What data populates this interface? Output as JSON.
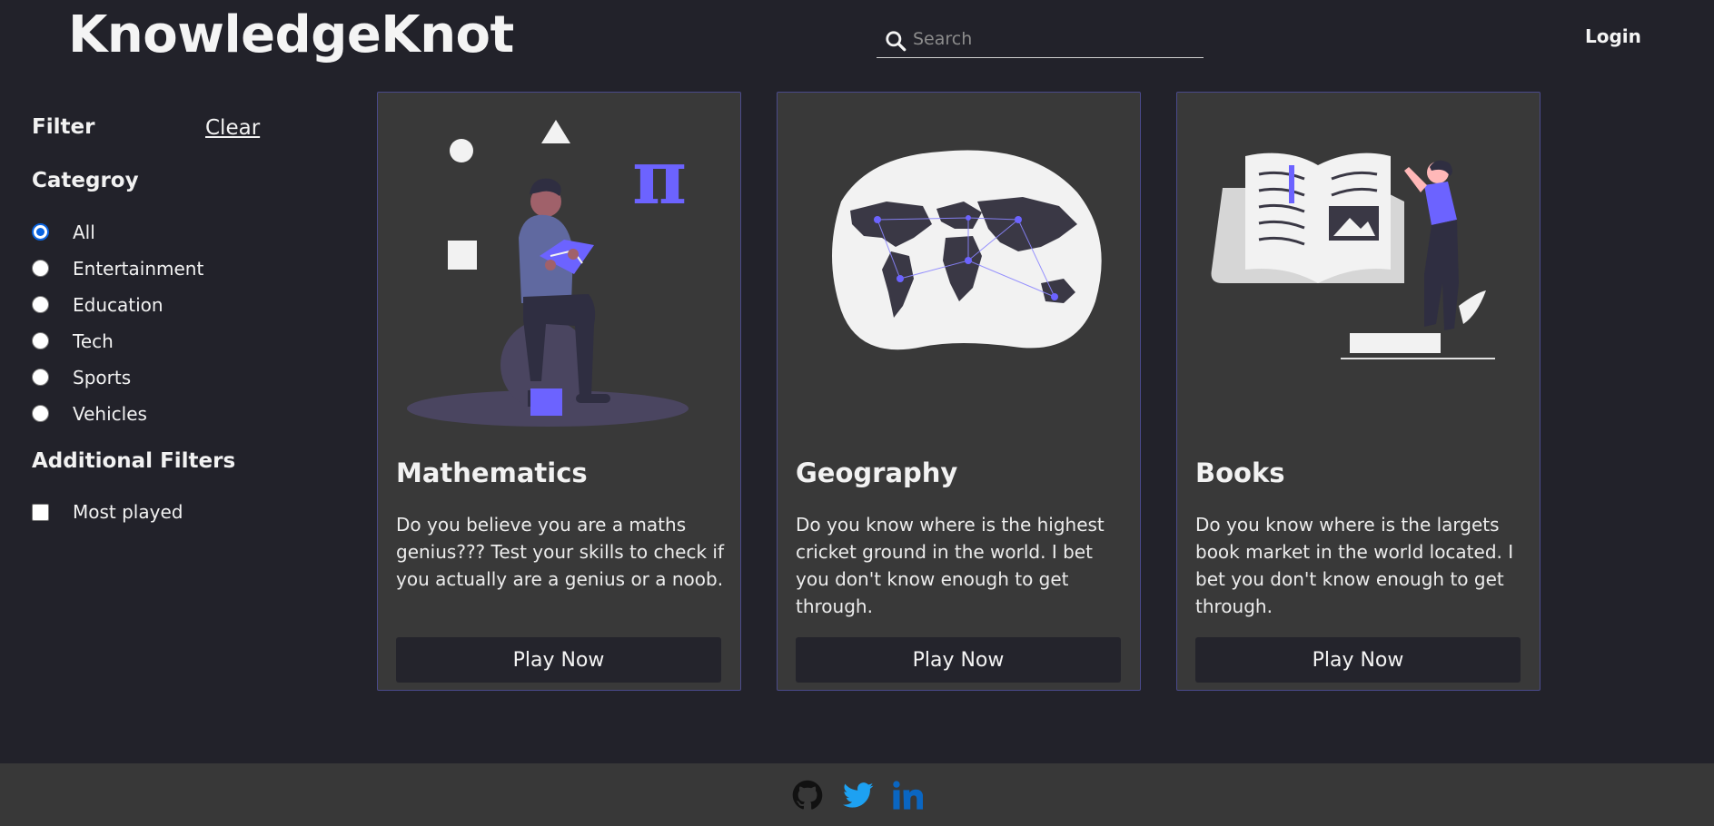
{
  "header": {
    "logo": "KnowledgeKnot",
    "search_placeholder": "Search",
    "login_label": "Login"
  },
  "sidebar": {
    "filter_title": "Filter",
    "clear_label": "Clear",
    "category_title": "Categroy",
    "categories": [
      {
        "label": "All",
        "checked": true
      },
      {
        "label": "Entertainment",
        "checked": false
      },
      {
        "label": "Education",
        "checked": false
      },
      {
        "label": "Tech",
        "checked": false
      },
      {
        "label": "Sports",
        "checked": false
      },
      {
        "label": "Vehicles",
        "checked": false
      }
    ],
    "additional_title": "Additional Filters",
    "additional": [
      {
        "label": "Most played",
        "checked": false
      }
    ]
  },
  "cards": [
    {
      "title": "Mathematics",
      "description": "Do you believe you are a maths genius??? Test your skills to check if you actually are a genius or a noob.",
      "button": "Play Now",
      "icon": "math-illustration"
    },
    {
      "title": "Geography",
      "description": "Do you know where is the highest cricket ground in the world. I bet you don't know enough to get through.",
      "button": "Play Now",
      "icon": "world-map-illustration"
    },
    {
      "title": "Books",
      "description": "Do you know where is the largets book market in the world located. I bet you don't know enough to get through.",
      "button": "Play Now",
      "icon": "books-illustration"
    }
  ],
  "footer": {
    "icons": [
      "github-icon",
      "twitter-icon",
      "linkedin-icon"
    ]
  },
  "colors": {
    "background": "#22222a",
    "card": "#393939",
    "accent": "#6c63ff",
    "twitter": "#1da1f2",
    "linkedin": "#0a66c2"
  }
}
